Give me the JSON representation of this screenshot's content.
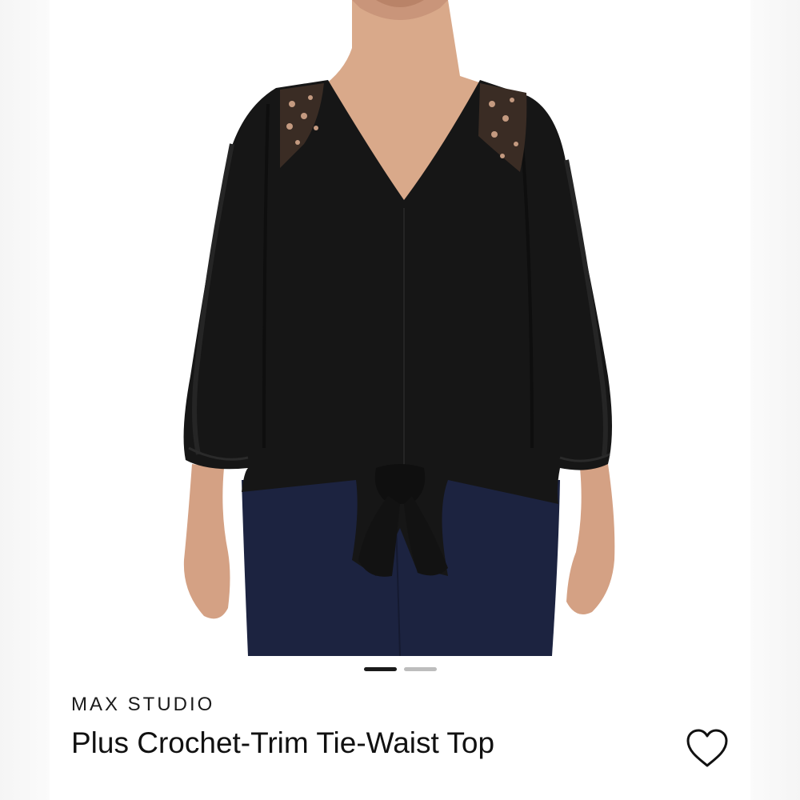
{
  "product": {
    "brand": "MAX STUDIO",
    "name": "Plus Crochet-Trim Tie-Waist Top"
  },
  "carousel": {
    "total": 2,
    "active": 1
  },
  "icons": {
    "favorite": "heart-outline-icon"
  },
  "colors": {
    "text": "#111111",
    "dot_active": "#1a1a1a",
    "dot_inactive": "#bdbdbd"
  }
}
